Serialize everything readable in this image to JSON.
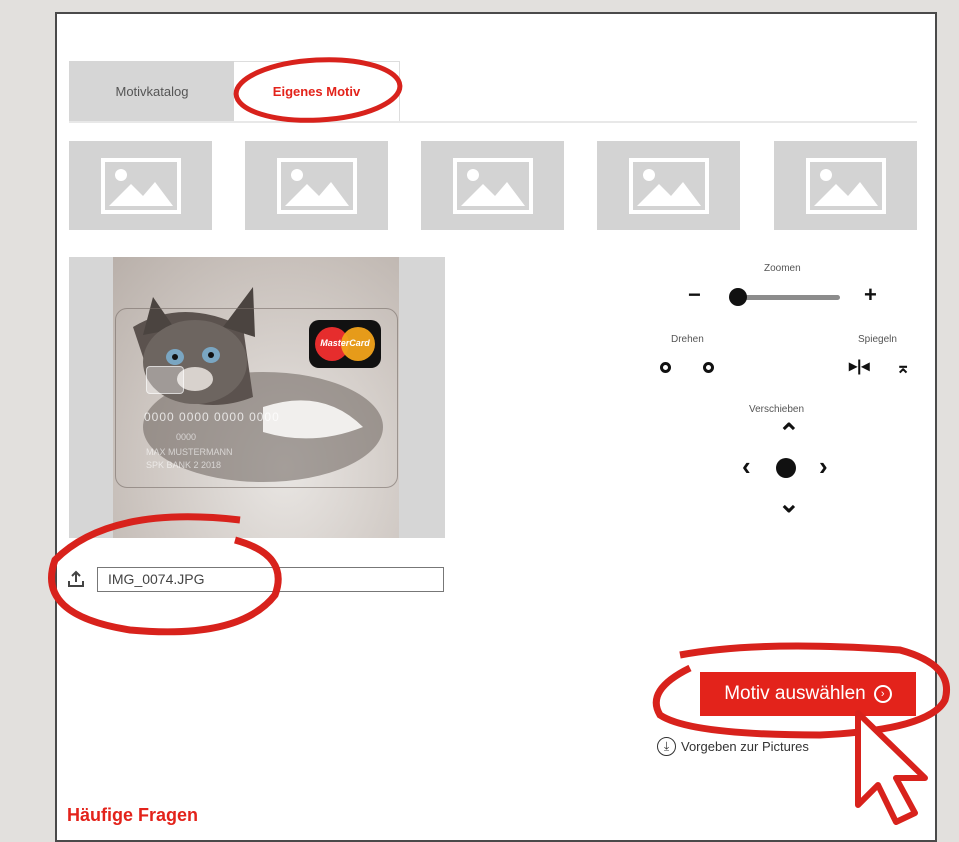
{
  "tabs": [
    {
      "label": "Motivkatalog",
      "active": false
    },
    {
      "label": "Eigenes Motiv",
      "active": true
    }
  ],
  "thumbnails_count": 5,
  "preview": {
    "brand_logo": "MasterCard",
    "card_number": "0000 0000 0000 0000",
    "card_lines": [
      "0000",
      "MAX MUSTERMANN",
      "SPK BANK 2 2018"
    ]
  },
  "upload": {
    "icon": "upload-icon",
    "file_name": "IMG_0074.JPG"
  },
  "controls": {
    "zoom_label": "Zoomen",
    "zoom_minus": "−",
    "zoom_plus": "+",
    "zoom_level_fraction": 0.0,
    "rotate_label": "Drehen",
    "mirror_label": "Spiegeln",
    "mirror_h_icon": "▸|◂",
    "mirror_v_icon": "⌅",
    "move_label": "Verschieben",
    "up": "⌃",
    "down": "⌄",
    "left": "‹",
    "right": "›"
  },
  "actions": {
    "select_button": "Motiv auswählen",
    "select_icon": "›",
    "download_text": "Vorgeben zur Pictures",
    "download_icon": "⤓"
  },
  "faq": {
    "title": "Häufige Fragen"
  },
  "colors": {
    "accent": "#e3231b",
    "annotation": "#d8221c",
    "tab_inactive": "#d6d6d6",
    "placeholder": "#d3d3d3"
  }
}
